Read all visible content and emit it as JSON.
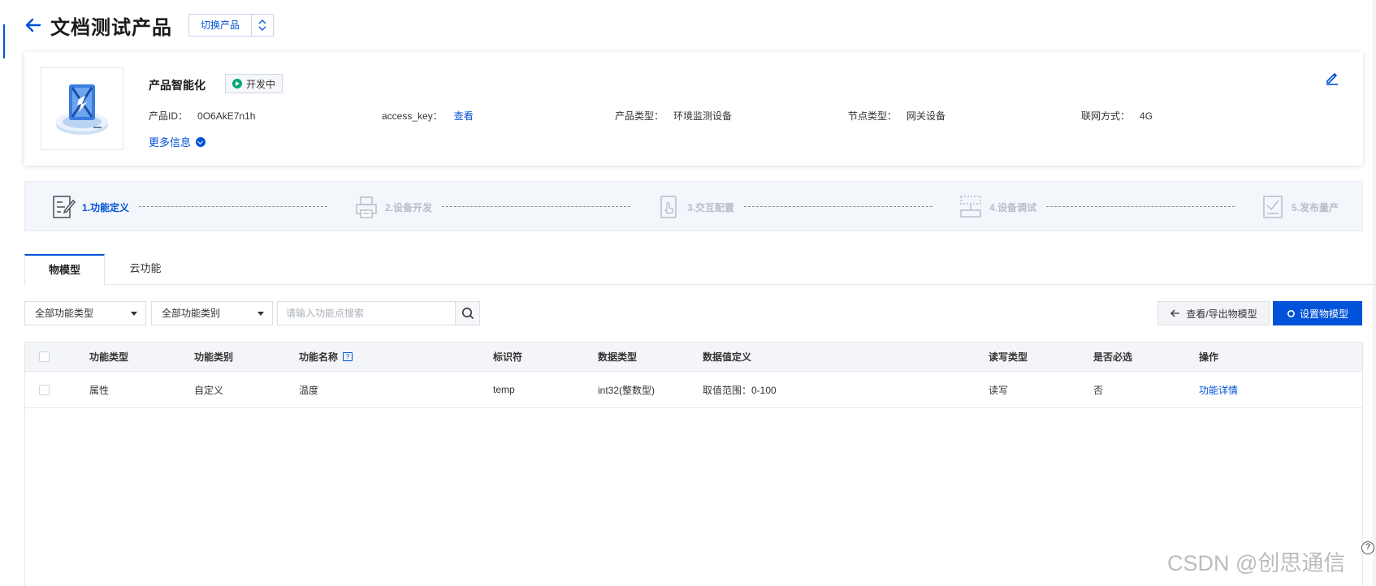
{
  "header": {
    "title": "文档测试产品",
    "switch_label": "切换产品"
  },
  "product": {
    "name": "产品智能化",
    "status": "开发中",
    "id_label": "产品ID：",
    "id_value": "0O6AkE7n1h",
    "access_key_label": "access_key：",
    "access_key_link": "查看",
    "type_label": "产品类型：",
    "type_value": "环境监测设备",
    "node_label": "节点类型：",
    "node_value": "网关设备",
    "network_label": "联网方式：",
    "network_value": "4G",
    "more_info": "更多信息"
  },
  "steps": [
    {
      "label": "1.功能定义",
      "icon": "document-edit-icon"
    },
    {
      "label": "2.设备开发",
      "icon": "printer-icon"
    },
    {
      "label": "3.交互配置",
      "icon": "touch-screen-icon"
    },
    {
      "label": "4.设备调试",
      "icon": "device-debug-icon"
    },
    {
      "label": "5.发布量产",
      "icon": "checklist-icon"
    }
  ],
  "tabs": [
    {
      "label": "物模型"
    },
    {
      "label": "云功能"
    }
  ],
  "toolbar": {
    "type_select": "全部功能类型",
    "category_select": "全部功能类别",
    "search_placeholder": "请输入功能点搜索",
    "export_label": "查看/导出物模型",
    "set_label": "设置物模型"
  },
  "table": {
    "columns": [
      "功能类型",
      "功能类别",
      "功能名称",
      "标识符",
      "数据类型",
      "数据值定义",
      "读写类型",
      "是否必选",
      "操作"
    ],
    "rows": [
      [
        "属性",
        "自定义",
        "温度",
        "temp",
        "int32(整数型)",
        "取值范围：0-100",
        "读写",
        "否",
        "功能详情"
      ]
    ]
  },
  "watermark": "CSDN @创思通信",
  "colors": {
    "primary": "#0052d9",
    "status_green": "#00a870",
    "step_inactive": "#b8bec9"
  }
}
